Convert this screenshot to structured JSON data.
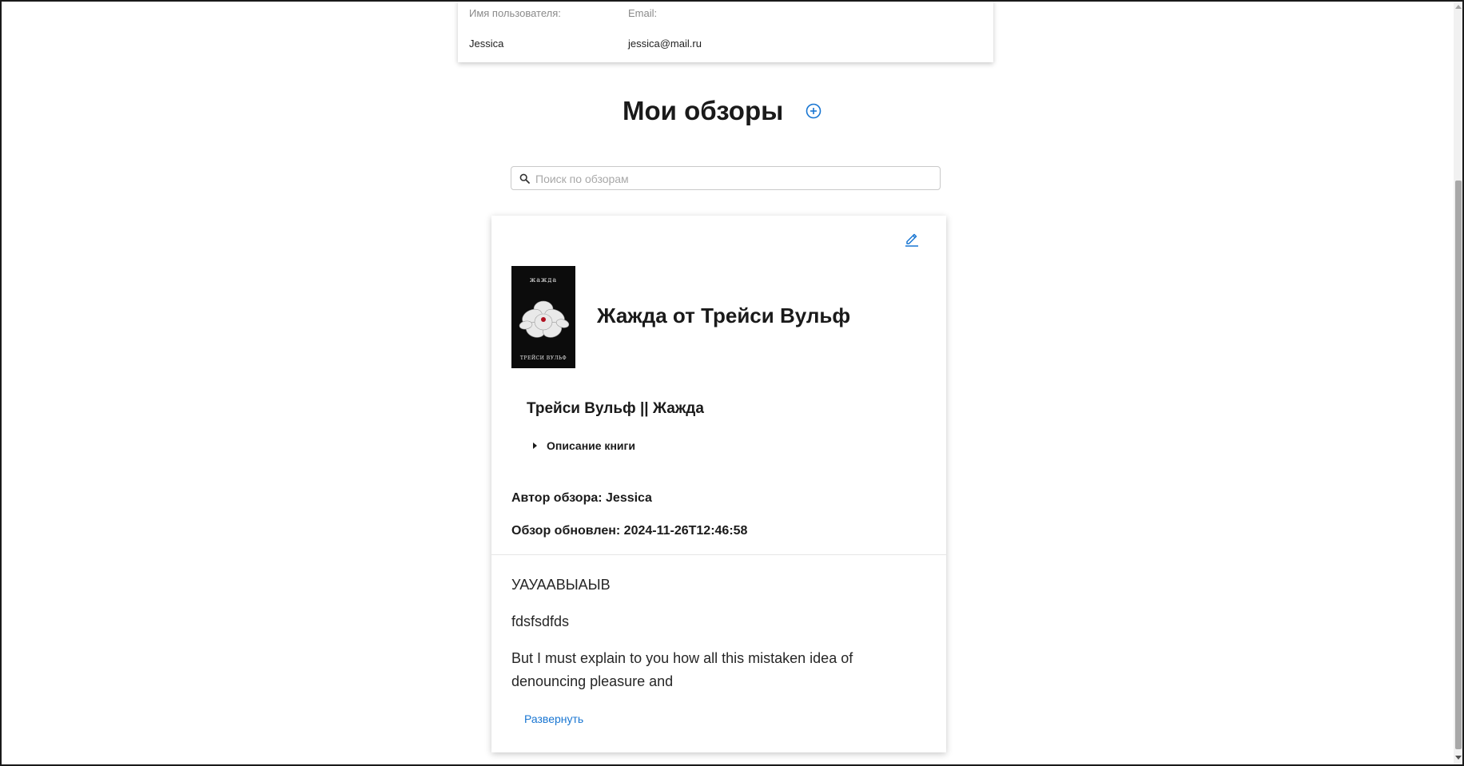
{
  "user_info": {
    "username_label": "Имя пользователя:",
    "username_value": "Jessica",
    "email_label": "Email:",
    "email_value": "jessica@mail.ru"
  },
  "page": {
    "title": "Мои обзоры",
    "add_icon": "plus-circle-icon"
  },
  "search": {
    "placeholder": "Поиск по обзорам",
    "value": "",
    "icon": "search-icon"
  },
  "review": {
    "edit_icon": "pencil-icon",
    "cover": {
      "title": "жажда",
      "author": "ТРЕЙСИ ВУЛЬФ"
    },
    "book_title": "Жажда от Трейси Вульф",
    "book_subtitle": "Трейси Вульф || Жажда",
    "description_toggle": "Описание книги",
    "author_line": "Автор обзора: Jessica",
    "updated_line": "Обзор обновлен: 2024-11-26T12:46:58",
    "paragraphs": [
      "УАУААВЫАЫВ",
      "fdsfsdfds",
      "But I must explain to you how all this mistaken idea of denouncing pleasure and"
    ],
    "expand_label": "Развернуть"
  },
  "colors": {
    "accent": "#1976d2",
    "text": "#212121",
    "muted": "#8a8a8a"
  }
}
